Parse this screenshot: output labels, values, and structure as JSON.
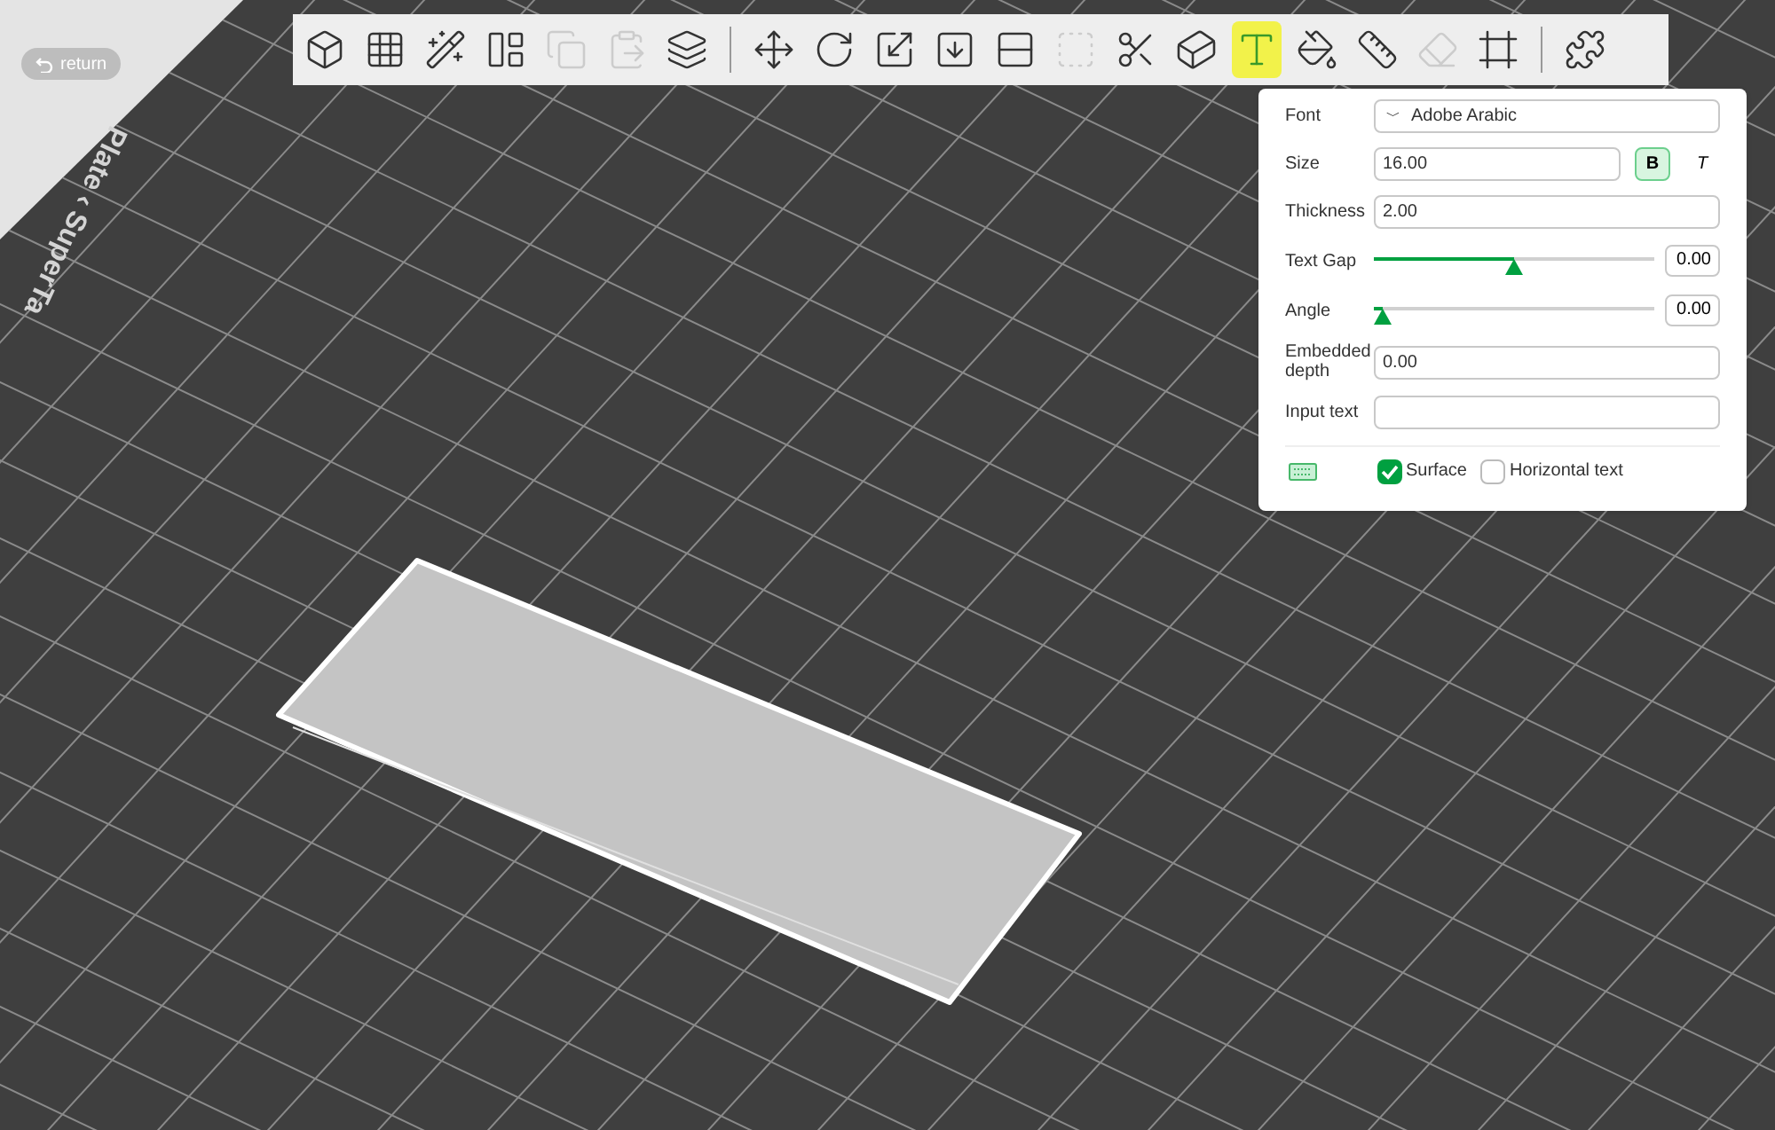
{
  "return_button": {
    "label": "return"
  },
  "plate_label": "Plate ‹ SuperTa",
  "toolbar": {
    "tools": [
      {
        "kind": "tool",
        "disabled": false,
        "selected": false
      },
      {
        "kind": "tool",
        "disabled": false,
        "selected": false
      },
      {
        "kind": "tool",
        "disabled": false,
        "selected": false
      },
      {
        "kind": "tool",
        "disabled": false,
        "selected": false
      },
      {
        "kind": "tool",
        "disabled": true,
        "selected": false
      },
      {
        "kind": "tool",
        "disabled": true,
        "selected": false
      },
      {
        "kind": "tool",
        "disabled": false,
        "selected": false
      },
      {
        "kind": "separator"
      },
      {
        "kind": "tool",
        "disabled": false,
        "selected": false
      },
      {
        "kind": "tool",
        "disabled": false,
        "selected": false
      },
      {
        "kind": "tool",
        "disabled": false,
        "selected": false
      },
      {
        "kind": "tool",
        "disabled": false,
        "selected": false
      },
      {
        "kind": "tool",
        "disabled": false,
        "selected": false
      },
      {
        "kind": "tool",
        "disabled": true,
        "selected": false
      },
      {
        "kind": "tool",
        "disabled": false,
        "selected": false
      },
      {
        "kind": "tool",
        "disabled": false,
        "selected": false
      },
      {
        "kind": "tool",
        "disabled": false,
        "selected": true
      },
      {
        "kind": "tool",
        "disabled": false,
        "selected": false
      },
      {
        "kind": "tool",
        "disabled": false,
        "selected": false
      },
      {
        "kind": "tool",
        "disabled": true,
        "selected": false
      },
      {
        "kind": "tool",
        "disabled": false,
        "selected": false
      },
      {
        "kind": "separator"
      },
      {
        "kind": "tool",
        "disabled": false,
        "selected": false
      }
    ]
  },
  "text_panel": {
    "font": {
      "label": "Font",
      "value": "Adobe Arabic",
      "caret": "﹀"
    },
    "size": {
      "label": "Size",
      "value": "16.00",
      "bold": {
        "label": "B",
        "selected": true
      },
      "italic": {
        "label": "T",
        "selected": false
      }
    },
    "thickness": {
      "label": "Thickness",
      "value": "2.00"
    },
    "text_gap": {
      "label": "Text Gap",
      "level": 0.5,
      "value": "0.00"
    },
    "angle": {
      "label": "Angle",
      "level": 0.03,
      "value": "0.00"
    },
    "embedded_depth": {
      "label": "Embedded depth",
      "value": "0.00"
    },
    "input_text": {
      "label": "Input text"
    },
    "options": [
      {
        "label": "Surface",
        "checked": true
      },
      {
        "label": "Horizontal text",
        "checked": false
      }
    ]
  }
}
